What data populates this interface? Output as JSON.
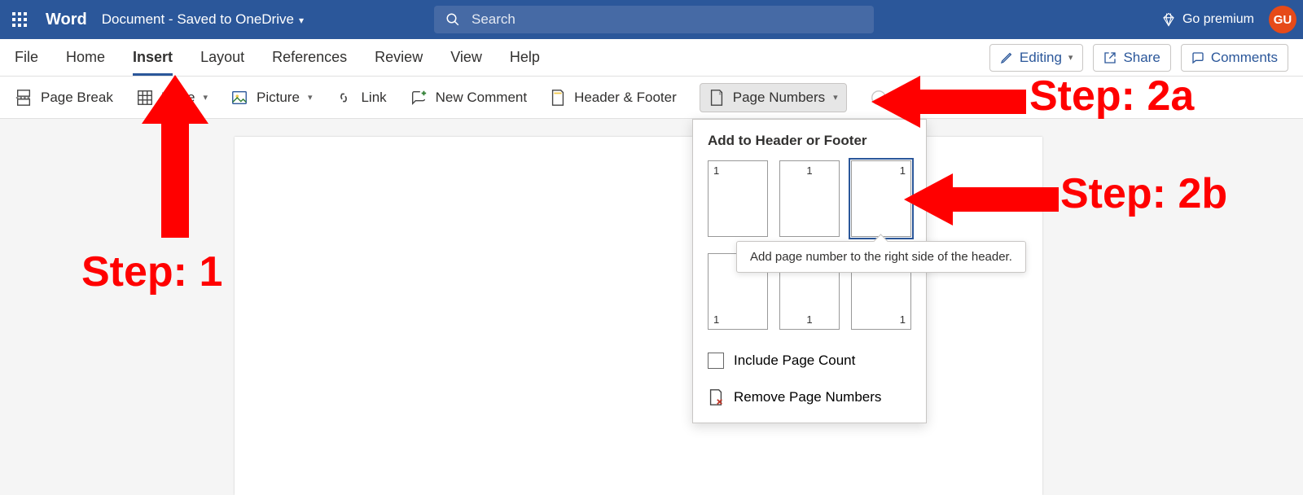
{
  "titlebar": {
    "app_name": "Word",
    "doc_title": "Document - Saved to OneDrive",
    "search_placeholder": "Search",
    "go_premium": "Go premium",
    "avatar_initials": "GU"
  },
  "tabs": {
    "items": [
      "File",
      "Home",
      "Insert",
      "Layout",
      "References",
      "Review",
      "View",
      "Help"
    ],
    "active_index": 2,
    "editing_label": "Editing",
    "share_label": "Share",
    "comments_label": "Comments"
  },
  "ribbon": {
    "page_break": "Page Break",
    "table": "Table",
    "picture": "Picture",
    "link": "Link",
    "new_comment": "New Comment",
    "header_footer": "Header & Footer",
    "page_numbers": "Page Numbers"
  },
  "dropdown": {
    "title": "Add to Header or Footer",
    "sample_num": "1",
    "tooltip": "Add page number to the right side of the header.",
    "include_page_count": "Include Page Count",
    "remove": "Remove Page Numbers"
  },
  "annotations": {
    "step1": "Step: 1",
    "step2a": "Step: 2a",
    "step2b": "Step: 2b"
  }
}
